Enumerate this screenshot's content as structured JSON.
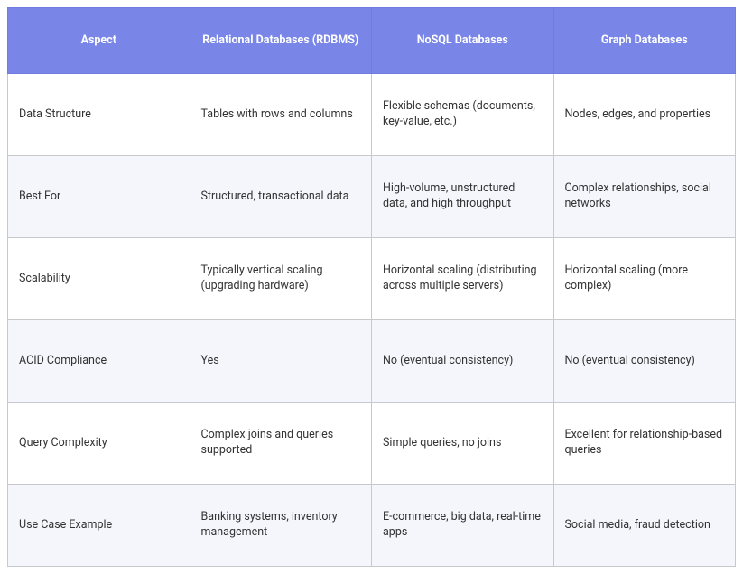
{
  "headers": [
    "Aspect",
    "Relational Databases (RDBMS)",
    "NoSQL Databases",
    "Graph Databases"
  ],
  "rows": [
    {
      "aspect": "Data Structure",
      "rdbms": "Tables with rows and columns",
      "nosql": "Flexible schemas (documents, key-value, etc.)",
      "graph": "Nodes, edges, and properties"
    },
    {
      "aspect": "Best For",
      "rdbms": "Structured, transactional data",
      "nosql": "High-volume, unstructured data, and high throughput",
      "graph": "Complex relationships, social networks"
    },
    {
      "aspect": "Scalability",
      "rdbms": "Typically vertical scaling (upgrading hardware)",
      "nosql": "Horizontal scaling (distributing across multiple servers)",
      "graph": "Horizontal scaling (more complex)"
    },
    {
      "aspect": "ACID Compliance",
      "rdbms": "Yes",
      "nosql": "No (eventual consistency)",
      "graph": "No (eventual consistency)"
    },
    {
      "aspect": "Query Complexity",
      "rdbms": "Complex joins and queries supported",
      "nosql": "Simple queries, no joins",
      "graph": "Excellent for relationship-based queries"
    },
    {
      "aspect": "Use Case Example",
      "rdbms": "Banking systems, inventory management",
      "nosql": "E-commerce, big data, real-time apps",
      "graph": "Social media, fraud detection"
    }
  ]
}
